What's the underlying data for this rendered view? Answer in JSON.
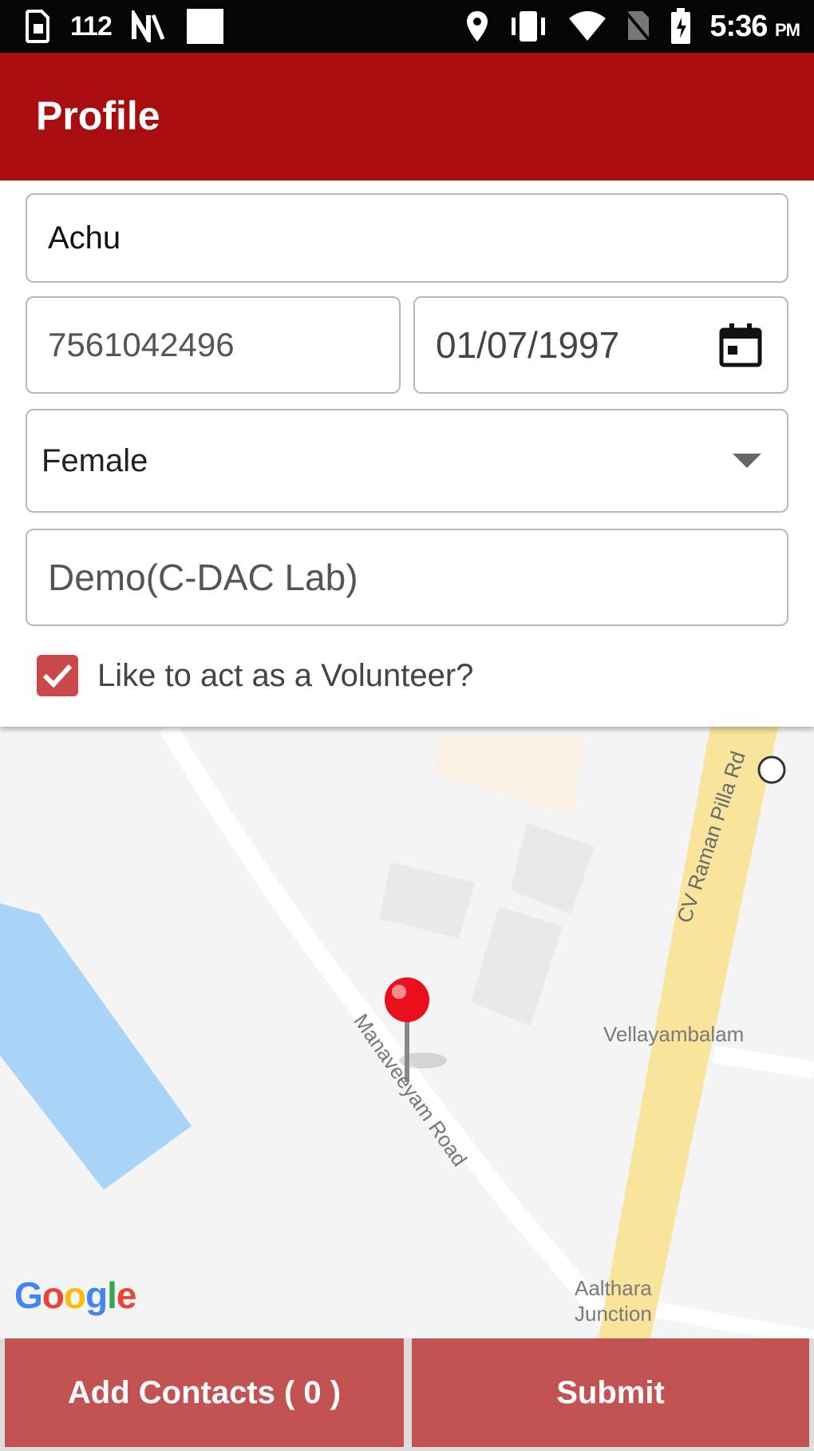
{
  "status_bar": {
    "signal_text": "112",
    "time": "5:36",
    "ampm": "PM"
  },
  "app_bar": {
    "title": "Profile"
  },
  "form": {
    "name": "Achu",
    "phone": "7561042496",
    "dob": "01/07/1997",
    "gender_selected": "Female",
    "organization": "Demo(C-DAC Lab)",
    "volunteer_label": "Like to act as a Volunteer?",
    "volunteer_checked": true
  },
  "map": {
    "labels": {
      "cv_road": "CV Raman Pilla Rd",
      "vellayambalam": "Vellayambalam",
      "road": "Manaveeyam Road",
      "aalthara_1": "Aalthara",
      "aalthara_2": "Junction"
    },
    "logo": [
      "G",
      "o",
      "o",
      "g",
      "l",
      "e"
    ],
    "logo_colors": [
      "#4285F4",
      "#EA4335",
      "#FBBC05",
      "#4285F4",
      "#34A853",
      "#EA4335"
    ],
    "marker_color": "#e8101c"
  },
  "actions": {
    "add_contacts": "Add Contacts ( 0 )",
    "submit": "Submit"
  },
  "colors": {
    "app_bar": "#a80e0f",
    "button": "#c25352",
    "checkbox": "#c9484a"
  }
}
